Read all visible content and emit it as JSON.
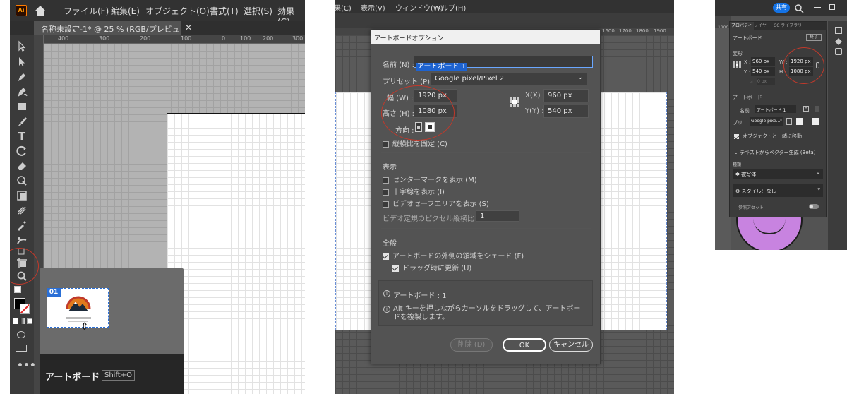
{
  "panel1": {
    "app_icon": "Ai",
    "menu": [
      "ファイル(F)",
      "編集(E)",
      "オブジェクト(O)",
      "書式(T)",
      "選択(S)",
      "効果(C)"
    ],
    "doc_tab": "名称未設定-1* @ 25 % (RGB/プレビュー)",
    "ruler": [
      "400",
      "300",
      "200",
      "100",
      "0",
      "100",
      "200",
      "300",
      "400"
    ],
    "tooltip": {
      "badge": "01",
      "title": "アートボード",
      "shortcut": "Shift+O"
    }
  },
  "panel2": {
    "menu": [
      "ォ果(C)",
      "表示(V)",
      "ウィンドウ(W)",
      "ヘルプ(H)"
    ],
    "ruler": [
      "1600",
      "1700",
      "1800",
      "1900"
    ],
    "dialog": {
      "title": "アートボードオプション",
      "name_label": "名前 (N) :",
      "name_value": "アートボード 1",
      "preset_label": "プリセット (P) :",
      "preset_value": "Google pixel/Pixel 2",
      "width_label": "幅 (W) :",
      "width_value": "1920 px",
      "height_label": "高さ (H) :",
      "height_value": "1080 px",
      "x_label": "X(X) :",
      "x_value": "960 px",
      "y_label": "Y(Y) :",
      "y_value": "540 px",
      "orientation_label": "方向 :",
      "ratio_label": "縦横比を固定 (C)",
      "display_section": "表示",
      "center_mark": "センターマークを表示 (M)",
      "cross_hair": "十字線を表示 (I)",
      "video_safe": "ビデオセーフエリアを表示 (S)",
      "pixel_ratio_label": "ビデオ定規のピクセル縦横比 (L) :",
      "pixel_ratio_value": "1",
      "global_section": "全般",
      "fade_outside": "アートボードの外側の領域をシェード (F)",
      "update_drag": "ドラッグ時に更新 (U)",
      "info_count": "アートボード : 1",
      "info_tip": "Alt キーを押しながらカーソルをドラッグして、アートボードを複製します。",
      "delete_btn": "削除 (D)",
      "ok_btn": "OK",
      "cancel_btn": "キャンセル"
    }
  },
  "panel3": {
    "share": "共有",
    "ruler": "1900",
    "tabs": [
      "プロパティ",
      "レイヤー",
      "CC ライブラリ"
    ],
    "section_artboard": "アートボード",
    "end_btn": "終了",
    "transform_label": "変形",
    "x_label": "X :",
    "x_value": "960 px",
    "y_label": "Y :",
    "y_value": "540 px",
    "w_label": "W :",
    "w_value": "1920 px",
    "h_label": "H :",
    "h_value": "1080 px",
    "angle_value": "0 px",
    "artboard_section": "アートボード",
    "name_label": "名前 :",
    "name_value": "アートボード 1",
    "preset_label": "プリ...",
    "preset_value": "Google pixe...",
    "move_with_artboard": "オブジェクトと一緒に移動",
    "text_to_vector": "テキストからベクター生成 (Beta)",
    "type_label": "種類",
    "type_value": "被写体",
    "style_value": "スタイル：なし",
    "ref_asset": "参照アセット"
  }
}
